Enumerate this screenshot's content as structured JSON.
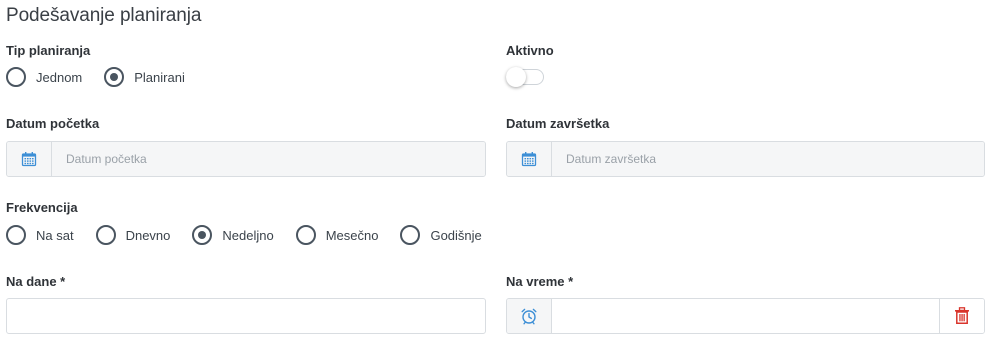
{
  "page": {
    "title": "Podešavanje planiranja"
  },
  "schedule_type": {
    "label": "Tip planiranja",
    "options": [
      {
        "label": "Jednom",
        "checked": false
      },
      {
        "label": "Planirani",
        "checked": true
      }
    ]
  },
  "active": {
    "label": "Aktivno",
    "enabled": false
  },
  "start_date": {
    "label": "Datum početka",
    "placeholder": "Datum početka",
    "value": ""
  },
  "end_date": {
    "label": "Datum završetka",
    "placeholder": "Datum završetka",
    "value": ""
  },
  "frequency": {
    "label": "Frekvencija",
    "options": [
      {
        "label": "Na sat",
        "checked": false
      },
      {
        "label": "Dnevno",
        "checked": false
      },
      {
        "label": "Nedeljno",
        "checked": true
      },
      {
        "label": "Mesečno",
        "checked": false
      },
      {
        "label": "Godišnje",
        "checked": false
      }
    ]
  },
  "days": {
    "label": "Na dane *",
    "value": ""
  },
  "time": {
    "label": "Na vreme *",
    "value": ""
  },
  "icons": {
    "calendar": "calendar-icon",
    "clock": "alarm-clock-icon",
    "delete": "trash-icon"
  },
  "colors": {
    "accent_blue": "#3d8fd6",
    "delete_red": "#d9342b",
    "radio_dark": "#4a5560"
  }
}
